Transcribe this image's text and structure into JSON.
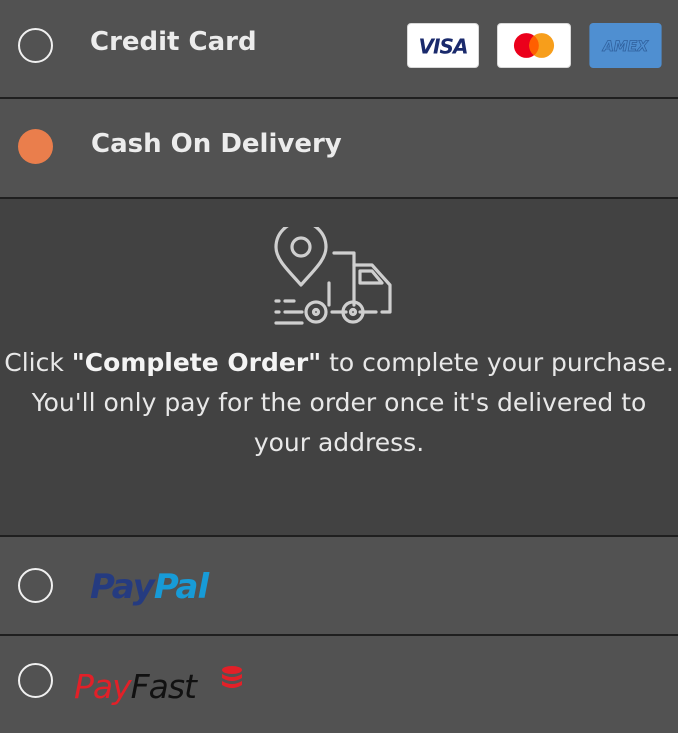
{
  "payment_options": {
    "credit_card": {
      "label": "Credit Card",
      "selected": false,
      "cards": [
        {
          "name": "VISA",
          "icon": "visa-card-icon"
        },
        {
          "name": "Mastercard",
          "icon": "mastercard-card-icon"
        },
        {
          "name": "AMEX",
          "icon": "amex-card-icon"
        }
      ]
    },
    "cash_on_delivery": {
      "label": "Cash On Delivery",
      "selected": true,
      "icon": "delivery-truck-location-icon",
      "instruction_prefix": "Click ",
      "instruction_emphasis": "\"Complete Order\"",
      "instruction_suffix": " to complete your purchase.",
      "instruction_line2": "You'll only pay for the order once it's delivered to your address."
    },
    "paypal": {
      "logo_part1": "Pay",
      "logo_part2": "Pal",
      "selected": false
    },
    "payfast": {
      "logo_part1": "Pay",
      "logo_part2": "Fast",
      "logo_icon": "coin-stack-icon",
      "selected": false
    }
  },
  "colors": {
    "accent": "#ea7e4c",
    "panel_bg": "#525252",
    "expanded_bg": "#424242",
    "divider": "#1f1f1f",
    "paypal_dark": "#253b80",
    "paypal_light": "#179bd7",
    "payfast_red": "#e22028",
    "amex_blue": "#4f8fd1"
  }
}
